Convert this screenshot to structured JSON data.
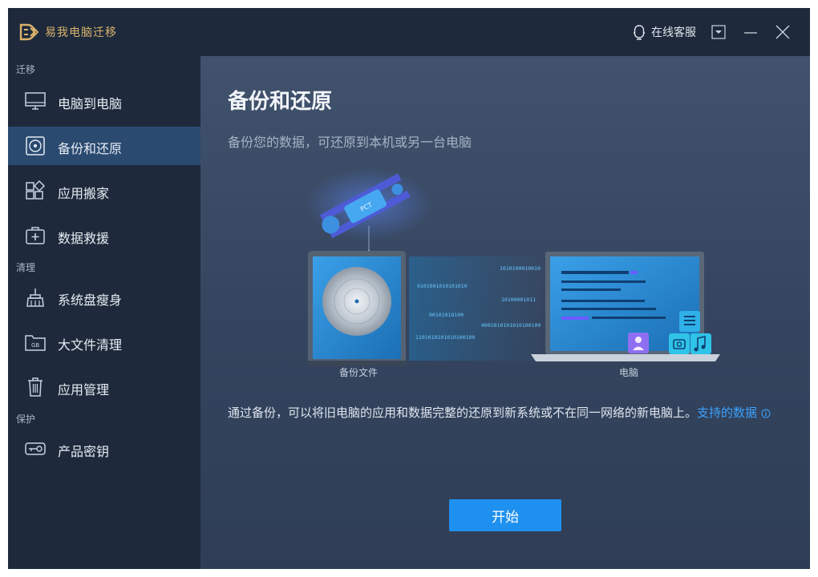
{
  "app": {
    "title": "易我电脑迁移"
  },
  "titlebar": {
    "support_label": "在线客服"
  },
  "sidebar": {
    "sections": [
      {
        "label": "迁移"
      },
      {
        "label": "清理"
      },
      {
        "label": "保护"
      }
    ],
    "items": [
      {
        "label": "电脑到电脑",
        "icon": "monitor-icon"
      },
      {
        "label": "备份和还原",
        "icon": "backup-disk-icon",
        "active": true
      },
      {
        "label": "应用搬家",
        "icon": "apps-icon"
      },
      {
        "label": "数据救援",
        "icon": "first-aid-icon"
      },
      {
        "label": "系统盘瘦身",
        "icon": "broom-icon"
      },
      {
        "label": "大文件清理",
        "icon": "gb-folder-icon"
      },
      {
        "label": "应用管理",
        "icon": "trash-icon"
      },
      {
        "label": "产品密钥",
        "icon": "key-icon"
      }
    ]
  },
  "main": {
    "title": "备份和还原",
    "subtitle": "备份您的数据，可还原到本机或另一台电脑",
    "illustration": {
      "backup_caption": "备份文件",
      "pc_caption": "电脑",
      "satellite_text": "PCT",
      "binary_lines": [
        "1010100010010",
        "0101001010101010",
        "10100001011",
        "00101010100",
        "0001010101010100100",
        "1101010101010100100"
      ]
    },
    "description": "通过备份，可以将旧电脑的应用和数据完整的还原到新系统或不在同一网络的新电脑上。",
    "link_label": "支持的数据",
    "start_button": "开始"
  },
  "colors": {
    "accent": "#1e90f0",
    "link": "#3ba2ff",
    "sidebar_bg": "#1e2a3b",
    "active_bg": "#2b4a70",
    "brand_gold": "#d9b36c"
  }
}
